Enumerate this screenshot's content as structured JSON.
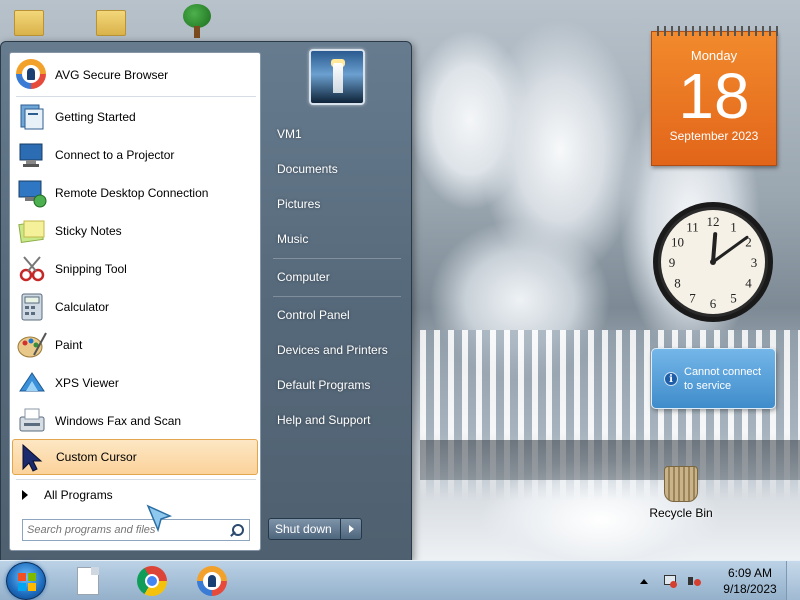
{
  "start_menu": {
    "pinned_apps": [
      {
        "label": "AVG Secure Browser",
        "icon": "avg-browser-icon"
      },
      {
        "label": "Getting Started",
        "icon": "getting-started-icon"
      },
      {
        "label": "Connect to a Projector",
        "icon": "projector-icon"
      },
      {
        "label": "Remote Desktop Connection",
        "icon": "remote-desktop-icon"
      },
      {
        "label": "Sticky Notes",
        "icon": "sticky-notes-icon"
      },
      {
        "label": "Snipping Tool",
        "icon": "snipping-tool-icon"
      },
      {
        "label": "Calculator",
        "icon": "calculator-icon"
      },
      {
        "label": "Paint",
        "icon": "paint-icon"
      },
      {
        "label": "XPS Viewer",
        "icon": "xps-viewer-icon"
      },
      {
        "label": "Windows Fax and Scan",
        "icon": "fax-scan-icon"
      },
      {
        "label": "Custom Cursor",
        "icon": "custom-cursor-icon",
        "selected": true
      }
    ],
    "all_programs_label": "All Programs",
    "search_placeholder": "Search programs and files",
    "right_items": [
      "VM1",
      "Documents",
      "Pictures",
      "Music",
      "Computer",
      "Control Panel",
      "Devices and Printers",
      "Default Programs",
      "Help and Support"
    ],
    "shutdown_label": "Shut down"
  },
  "gadgets": {
    "calendar": {
      "weekday": "Monday",
      "day": "18",
      "month_year": "September 2023",
      "color": "#e8701f"
    },
    "clock": {
      "hour": 12,
      "minute": 9,
      "numerals": [
        "12",
        "1",
        "2",
        "3",
        "4",
        "5",
        "6",
        "7",
        "8",
        "9",
        "10",
        "11"
      ]
    },
    "weather": {
      "message_line1": "Cannot connect",
      "message_line2": "to service"
    }
  },
  "desktop": {
    "recycle_bin_label": "Recycle Bin",
    "top_icons": [
      "folder-icon",
      "folder-icon",
      "tree-icon"
    ]
  },
  "taskbar": {
    "time": "6:09 AM",
    "date": "9/18/2023",
    "pinned": [
      "file-icon",
      "chrome-icon",
      "avg-browser-icon"
    ],
    "accent": "#a6c0d8"
  }
}
